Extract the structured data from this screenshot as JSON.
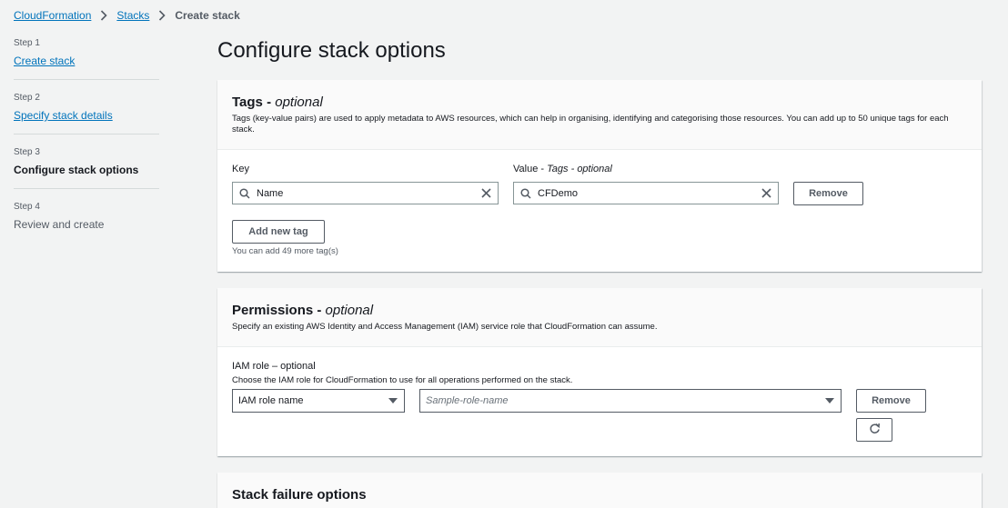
{
  "breadcrumb": {
    "items": [
      "CloudFormation",
      "Stacks"
    ],
    "current": "Create stack"
  },
  "steps": [
    {
      "num": "Step 1",
      "label": "Create stack",
      "state": "link"
    },
    {
      "num": "Step 2",
      "label": "Specify stack details",
      "state": "link"
    },
    {
      "num": "Step 3",
      "label": "Configure stack options",
      "state": "active"
    },
    {
      "num": "Step 4",
      "label": "Review and create",
      "state": "disabled"
    }
  ],
  "page_title": "Configure stack options",
  "tags": {
    "title": "Tags - ",
    "title_optional": "optional",
    "description": "Tags (key-value pairs) are used to apply metadata to AWS resources, which can help in organising, identifying and categorising those resources. You can add up to 50 unique tags for each stack.",
    "key_label": "Key",
    "value_label": "Value - ",
    "value_label_optional": "Tags - optional",
    "key_value": "Name",
    "value_value": "CFDemo",
    "remove_label": "Remove",
    "add_label": "Add new tag",
    "remaining_hint": "You can add 49 more tag(s)"
  },
  "permissions": {
    "title": "Permissions - ",
    "title_optional": "optional",
    "description": "Specify an existing AWS Identity and Access Management (IAM) service role that CloudFormation can assume.",
    "iam_label": "IAM role – optional",
    "iam_hint": "Choose the IAM role for CloudFormation to use for all operations performed on the stack.",
    "select_type": "IAM role name",
    "select_role_placeholder": "Sample-role-name",
    "remove_label": "Remove"
  },
  "failure": {
    "title": "Stack failure options"
  },
  "icons": {
    "search": "search-icon",
    "clear": "clear-icon",
    "caret": "caret-down-icon",
    "refresh": "refresh-icon",
    "chevron": "chevron-right-icon"
  }
}
